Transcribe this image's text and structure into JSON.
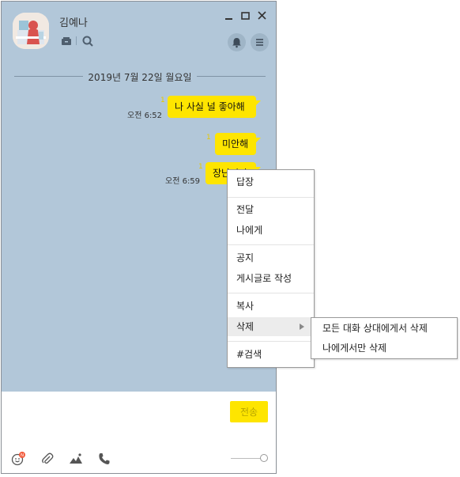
{
  "header": {
    "name": "김예나"
  },
  "date_separator": "2019년 7월 22일 월요일",
  "messages": [
    {
      "text": "나 사실 널 좋아해",
      "unread": "1",
      "time": "오전 6:52"
    },
    {
      "text": "미안해",
      "unread": "1",
      "time": ""
    },
    {
      "text": "장난이야",
      "unread": "1",
      "time": "오전 6:59"
    }
  ],
  "input": {
    "send_label": "전송"
  },
  "toolbar": {
    "emoji_badge": "N"
  },
  "context_menu": {
    "items": [
      "답장",
      "전달",
      "나에게",
      "공지",
      "게시글로 작성",
      "복사",
      "삭제",
      "#검색"
    ],
    "active": "삭제"
  },
  "delete_submenu": {
    "items": [
      "모든 대화 상대에게서 삭제",
      "나에게서만 삭제"
    ]
  }
}
